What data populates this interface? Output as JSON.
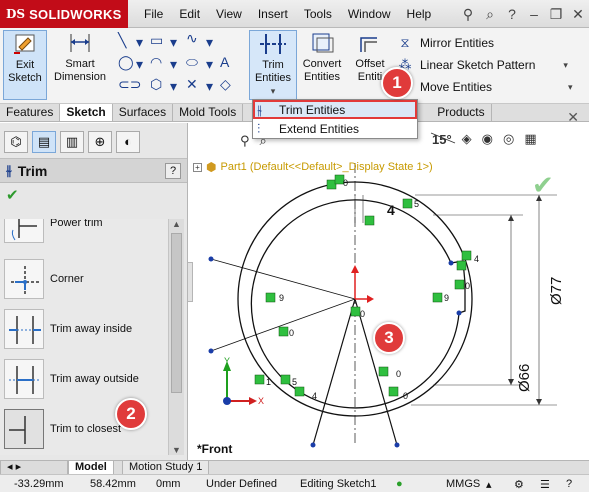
{
  "app": {
    "logo_mark": "DS",
    "logo_text": "SOLIDWORKS"
  },
  "menu": [
    "File",
    "Edit",
    "View",
    "Insert",
    "Tools",
    "Window",
    "Help"
  ],
  "ribbon": {
    "exit_sketch": [
      "Exit",
      "Sketch"
    ],
    "smart_dimension": [
      "Smart",
      "Dimension"
    ],
    "trim_entities": [
      "Trim",
      "Entities"
    ],
    "convert_entities": [
      "Convert",
      "Entities"
    ],
    "offset_entities": [
      "Offset",
      "Entiti"
    ],
    "mirror_entities": "Mirror Entities",
    "linear_pattern": "Linear Sketch Pattern",
    "move_entities": "Move Entities"
  },
  "tabs": [
    "Features",
    "Sketch",
    "Surfaces",
    "Mold Tools",
    "Products"
  ],
  "dropdown": {
    "trim": "Trim Entities",
    "extend": "Extend Entities"
  },
  "property_manager": {
    "title": "Trim",
    "help": "?",
    "options": [
      "Power trim",
      "Corner",
      "Trim away inside",
      "Trim away outside",
      "Trim to closest"
    ]
  },
  "graphics": {
    "part_label": "Part1  (Default<<Default>_Display State 1>)",
    "view_label": "*Front",
    "dim_small": "4",
    "dim_angle": "15°",
    "dim_d77": "Ø77",
    "dim_d66": "Ø66",
    "rel_labels": [
      "0",
      "5",
      "0",
      "9",
      "0",
      "9",
      "0",
      "0",
      "1",
      "5",
      "4",
      "4",
      "0"
    ],
    "axis_x": "X",
    "axis_y": "Y"
  },
  "bottom_tabs": [
    "Model",
    "Motion Study 1"
  ],
  "status": {
    "x": "-33.29mm",
    "y": "58.42mm",
    "z": "0mm",
    "state": "Under Defined",
    "editing": "Editing Sketch1",
    "units": "MMGS"
  },
  "callouts": [
    "1",
    "2",
    "3"
  ]
}
